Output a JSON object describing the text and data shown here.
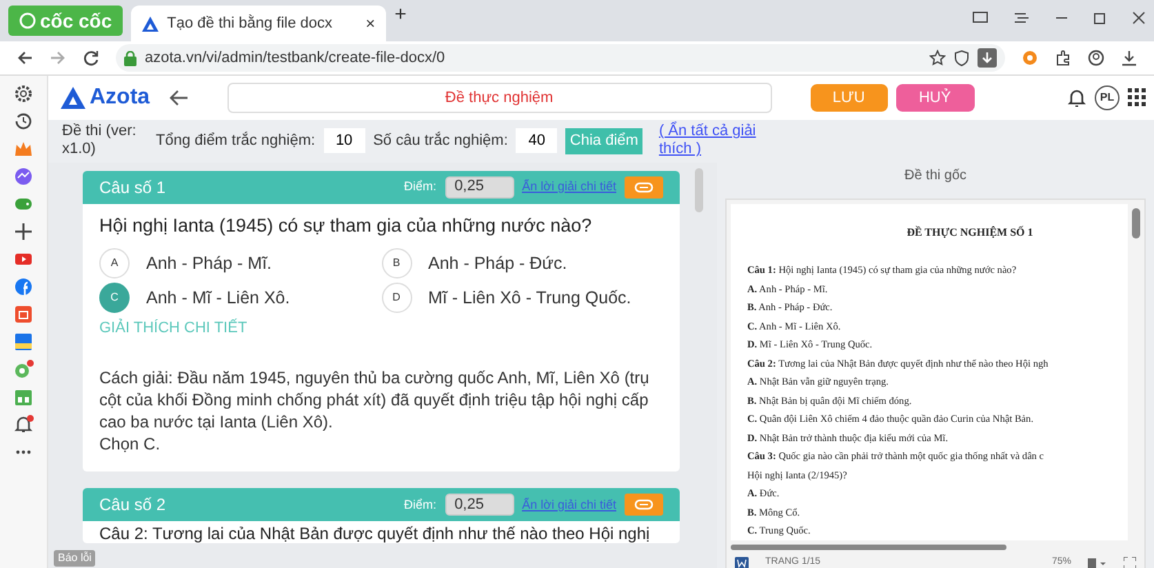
{
  "browser": {
    "brand": "cốc cốc",
    "tab_title": "Tạo đề thi bằng file docx",
    "tab_close": "×",
    "new_tab": "+",
    "url": "azota.vn/vi/admin/testbank/create-file-docx/0"
  },
  "sidebar": {
    "items": [
      {
        "kind": "settings",
        "notification": false
      },
      {
        "kind": "history",
        "notification": false
      },
      {
        "kind": "crown",
        "notification": false
      },
      {
        "kind": "messenger",
        "notification": false
      },
      {
        "kind": "game",
        "notification": false
      },
      {
        "kind": "add",
        "notification": false
      },
      {
        "kind": "video",
        "notification": false
      },
      {
        "kind": "facebook",
        "notification": false
      },
      {
        "kind": "shop",
        "notification": false
      },
      {
        "kind": "sale",
        "notification": false
      },
      {
        "kind": "chat",
        "notification": true
      },
      {
        "kind": "store",
        "notification": false
      },
      {
        "kind": "bell",
        "notification": true
      },
      {
        "kind": "more",
        "notification": false
      }
    ]
  },
  "app": {
    "logo": "Azota",
    "title": "Đề thực nghiệm",
    "save": "LƯU",
    "cancel": "HUỶ",
    "avatar": "PL"
  },
  "toolbar": {
    "version": "Đề thi (ver: x1.0)",
    "total_label": "Tổng điểm trắc nghiệm:",
    "total": "10",
    "count_label": "Số câu trắc nghiệm:",
    "count": "40",
    "split_button": "Chia điểm",
    "hide_all": "( Ẩn tất cả giải thích )"
  },
  "questions": [
    {
      "title": "Câu số 1",
      "points_label": "Điểm:",
      "points": "0,25",
      "hide_link": "Ẩn lời giải chi tiết",
      "text": "Hội nghị Ianta (1945) có sự tham gia của những nước nào?",
      "options": [
        {
          "letter": "A",
          "text": "Anh - Pháp - Mĩ.",
          "selected": false
        },
        {
          "letter": "B",
          "text": "Anh - Pháp - Đức.",
          "selected": false
        },
        {
          "letter": "C",
          "text": "Anh - Mĩ - Liên Xô.",
          "selected": true
        },
        {
          "letter": "D",
          "text": "Mĩ - Liên Xô - Trung Quốc.",
          "selected": false
        }
      ],
      "explanation_heading": "GIẢI THÍCH CHI TIẾT",
      "explanation": [
        "Cách giải: Đầu năm 1945, nguyên thủ ba cường quốc Anh, Mĩ, Liên Xô (trụ cột của khối Đồng minh chống phát xít) đã quyết định triệu tập hội nghị cấp cao ba nước tại Ianta (Liên Xô).",
        "Chọn C."
      ]
    },
    {
      "title": "Câu số 2",
      "points_label": "Điểm:",
      "points": "0,25",
      "hide_link": "Ẩn lời giải chi tiết",
      "text": "Câu 2: Tương lai của Nhật Bản được quyết định như thế nào theo Hội nghị"
    }
  ],
  "report": "Báo lỗi",
  "original": {
    "title": "Đề thi gốc",
    "doc_title": "ĐỀ THỰC NGHIỆM SỐ 1",
    "lines": [
      "**Câu 1:** Hội nghị Ianta (1945) có sự tham gia của những nước nào?",
      "**A.** Anh - Pháp - Mĩ.",
      "**B.** Anh - Pháp - Đức.",
      "**C.** Anh - Mĩ - Liên Xô.",
      "**D.** Mĩ - Liên Xô - Trung Quốc.",
      "**Câu 2:** Tương lai của Nhật Bản được quyết định như thế nào theo Hội ngh",
      "**A.** Nhật Bản vẫn giữ nguyên trạng.",
      "**B.** Nhật Bản bị quân đội Mĩ chiếm đóng.",
      "**C.** Quân đội Liên Xô chiếm 4 đảo thuộc quần đảo Curin của Nhật Bản.",
      "**D.** Nhật Bản trở thành thuộc địa kiểu mới của Mĩ.",
      "**Câu 3:** Quốc gia nào cần phải trở thành một quốc gia thống nhất và dân c",
      "Hội nghị Ianta (2/1945)?",
      "**A.** Đức.",
      "**B.** Mông Cổ.",
      "**C.** Trung Quốc."
    ],
    "page": "TRANG 1/15",
    "zoom": "75%"
  }
}
